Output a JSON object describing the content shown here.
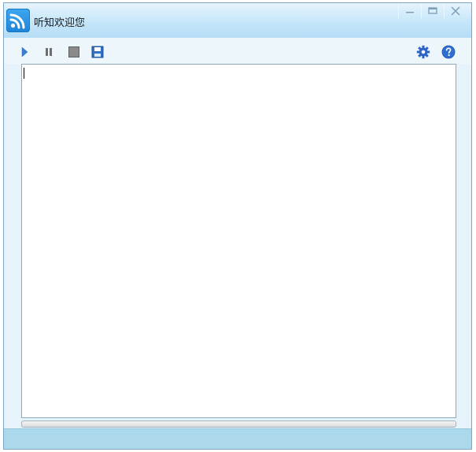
{
  "window": {
    "title": "听知欢迎您"
  },
  "toolbar": {
    "left": [
      {
        "icon": "play-icon"
      },
      {
        "icon": "pause-icon"
      },
      {
        "icon": "stop-icon"
      },
      {
        "icon": "save-icon"
      }
    ],
    "right": [
      {
        "icon": "settings-gear-icon"
      },
      {
        "icon": "help-icon"
      }
    ]
  },
  "editor": {
    "text": ""
  },
  "progress": {
    "value": 0
  },
  "colors": {
    "accent": "#1f84d8",
    "titlebar": "#c5e6fa",
    "statusbar": "#acd8ec"
  }
}
